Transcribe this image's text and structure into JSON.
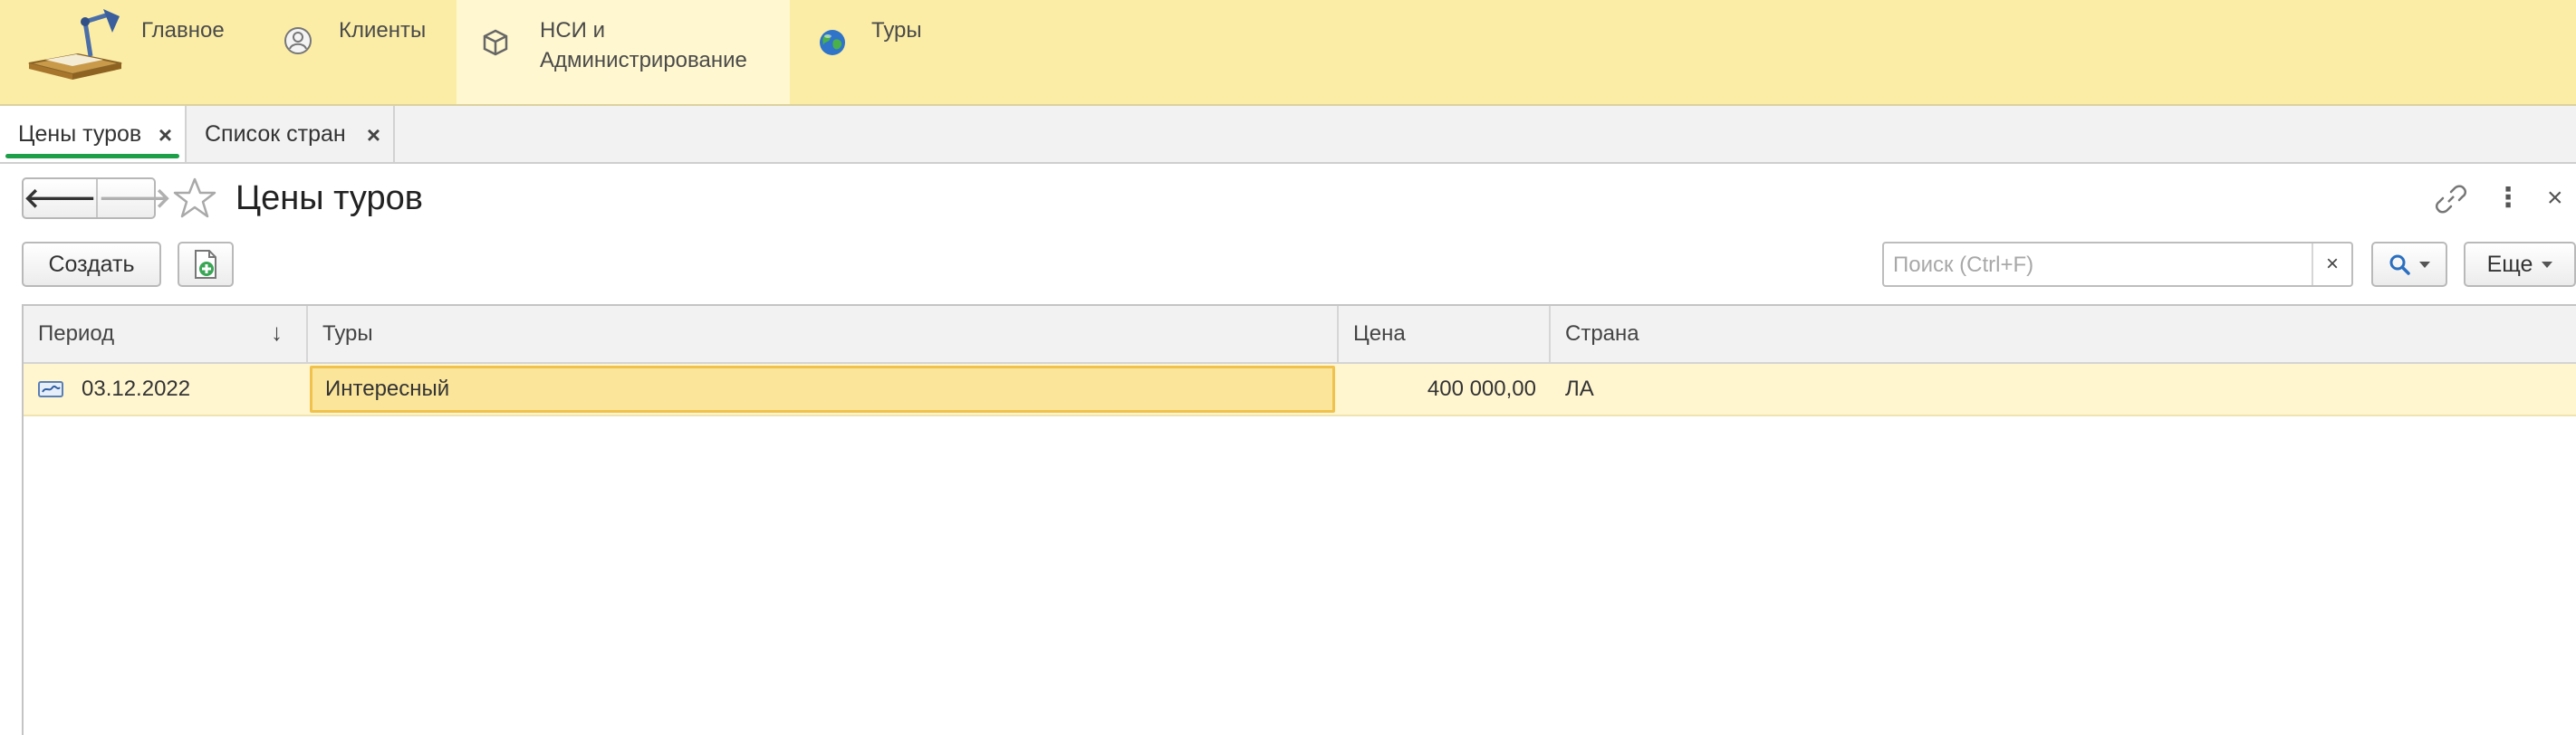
{
  "sections": {
    "main": "Главное",
    "clients": "Клиенты",
    "nsi": "НСИ и\nАдминистрирование",
    "tours": "Туры"
  },
  "tabs": [
    {
      "label": "Цены туров",
      "close": "×",
      "active": true
    },
    {
      "label": "Список стран",
      "close": "×",
      "active": false
    }
  ],
  "form": {
    "title": "Цены туров",
    "nav_back": "🡐",
    "nav_forward": "🡒"
  },
  "toolbar": {
    "create_label": "Создать",
    "search_placeholder": "Поиск (Ctrl+F)",
    "search_value": "",
    "search_clear": "×",
    "more_label": "Еще"
  },
  "table": {
    "columns": [
      "Период",
      "Туры",
      "Цена",
      "Страна"
    ],
    "sort_indicator": "↓",
    "rows": [
      {
        "period": "03.12.2022",
        "tour": "Интересный",
        "price": "400 000,00",
        "country": "ЛА"
      }
    ]
  },
  "colors": {
    "section_bar": "#fbeda6",
    "active_section": "#fff7cf",
    "active_tab_underline": "#1d9f4a",
    "selected_row": "#fff6d0",
    "selected_cell": "#fbe59b",
    "selected_cell_border": "#f0c24d"
  },
  "icons": {
    "logo": "desk-lamp-logo",
    "clients": "person-icon",
    "nsi": "cube-icon",
    "tours": "globe-icon",
    "favorite": "star-icon",
    "link": "link-icon",
    "more": "kebab-icon",
    "close": "close-icon",
    "copy": "copy-add-icon",
    "search": "search-icon",
    "row": "register-record-icon"
  }
}
